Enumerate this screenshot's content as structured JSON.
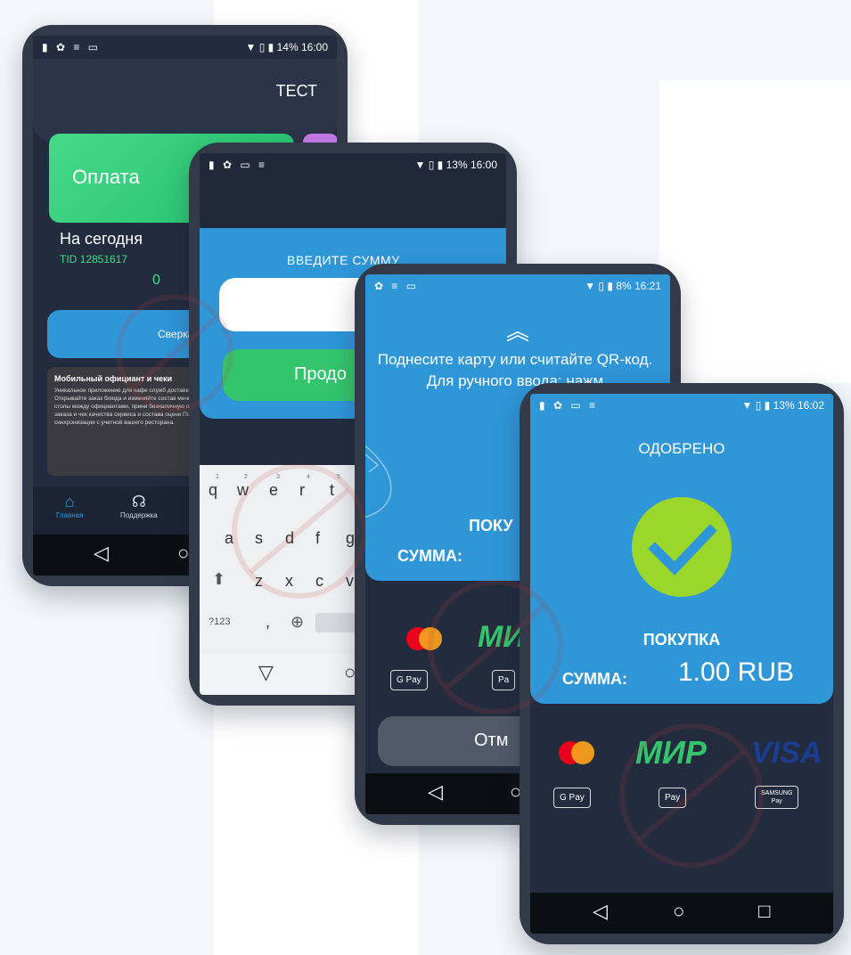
{
  "colors": {
    "dark_bg": "#232c3e",
    "accent_blue": "#2f96d8",
    "accent_green": "#33c46c",
    "check_green": "#9bd62a",
    "nav_black": "#0b0e13"
  },
  "phone1": {
    "status_left": "▮ ✿ ≡ ▭",
    "status_right": "▼ ▯ ▮ 14% 16:00",
    "header_title": "ТЕСТ",
    "pay_tile_label": "Оплата",
    "today_label": "На сегодня",
    "tid": "TID 12851617",
    "count": "0",
    "reconcile_button": "Сверка",
    "ad_title": "Мобильный официант и чеки",
    "ad_text": "Уникальное приложение для кафе служб доставки. Открывайте заказ блюда и изменяйте состав меню, столы между официантами, прини безналичную оплату заказа и чек качества сервиса и состава оцени Полная синхронизация с учетной вашего ресторана.",
    "tabs": [
      {
        "icon": "home-icon",
        "label": "Главная"
      },
      {
        "icon": "headset-icon",
        "label": "Поддержка"
      }
    ],
    "nav": {
      "back": "◁",
      "home": "○"
    }
  },
  "phone2": {
    "status_left": "▮ ✿ ▭ ≡",
    "status_right": "▼ ▯ ▮ 13% 16:00",
    "enter_amount_label": "ВВЕДИТЕ СУММУ",
    "continue_button": "Продо",
    "keyboard": {
      "row1": [
        "q",
        "w",
        "e",
        "r",
        "t"
      ],
      "row1_numbers": [
        "1",
        "2",
        "3",
        "4",
        "5"
      ],
      "row2": [
        "a",
        "s",
        "d",
        "f",
        "g"
      ],
      "row3": [
        "z",
        "x",
        "c",
        "v"
      ],
      "symbols_key": "?123",
      "comma_key": ",",
      "globe_key": "⊕",
      "space_label": "01"
    },
    "nav": {
      "back": "▽",
      "home": "○"
    }
  },
  "phone3": {
    "status_left": "✿ ≡ ▭",
    "status_right": "▼ ▯ ▮ 8% 16:21",
    "chevron": "︽",
    "prompt": "Поднесите карту или считайте QR-код. Для ручного ввода: нажм",
    "purchase_label": "ПОКУ",
    "sum_label": "СУММА:",
    "payment_brand": "МИ",
    "gpay_label": "G Pay",
    "apay_label": " Pa",
    "cancel_button": "Отм",
    "nav": {
      "back": "◁",
      "home": "○"
    }
  },
  "phone4": {
    "status_left": "▮ ✿ ▭ ≡",
    "status_right": "▼ ▯ ▮ 13% 16:02",
    "approved_label": "ОДОБРЕНО",
    "purchase_label": "ПОКУПКА",
    "sum_label": "СУММА:",
    "amount": "1.00 RUB",
    "brands": {
      "mir": "МИР",
      "visa": "VISA"
    },
    "gpay_label": "G Pay",
    "apay_label": " Pay",
    "samsung_label_top": "SAMSUNG",
    "samsung_label_bottom": "Pay",
    "nav": {
      "back": "◁",
      "home": "○",
      "recent": "□"
    }
  }
}
